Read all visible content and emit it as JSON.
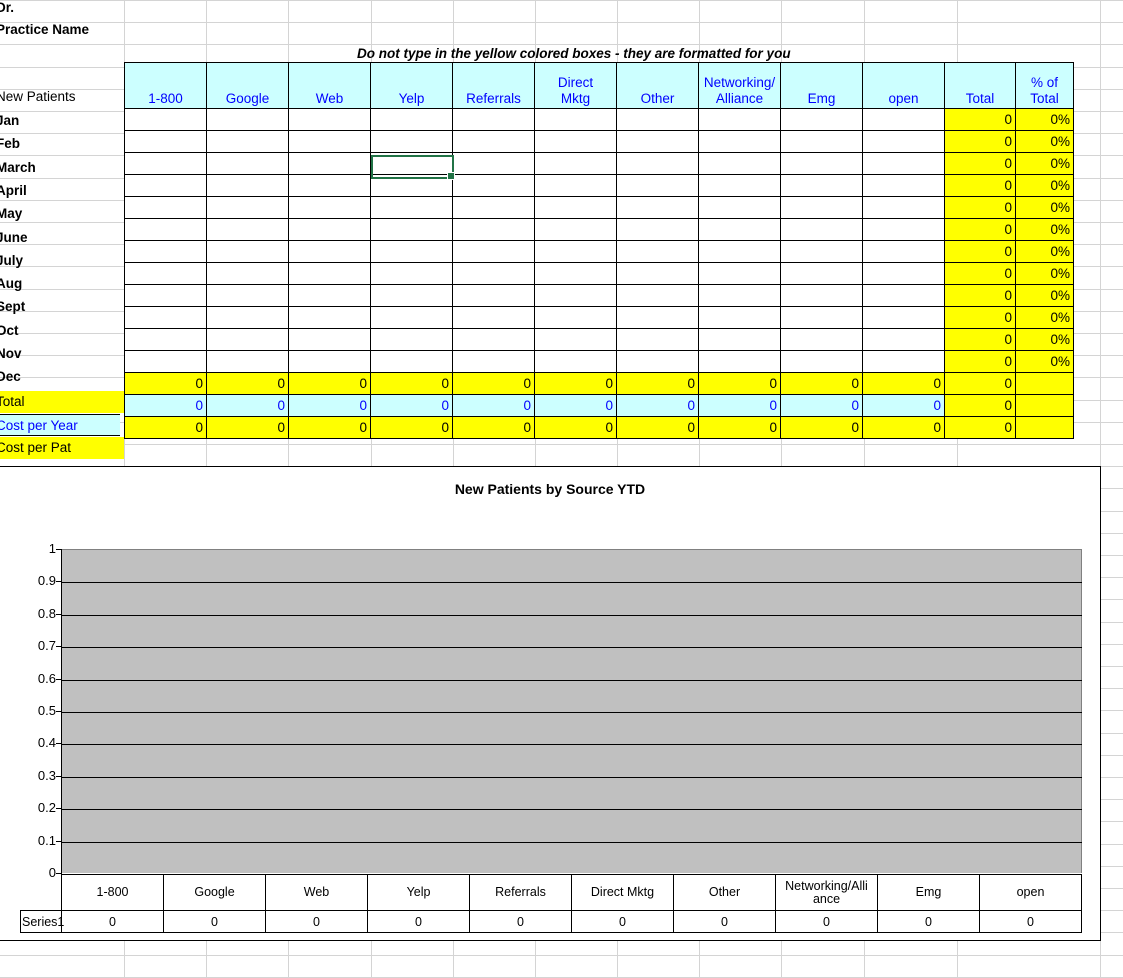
{
  "sheet": {
    "label_dr": "Dr.",
    "label_practice": "Practice Name",
    "label_new_patients": "New Patients",
    "note": "Do not type in the yellow colored boxes -  they are formatted for you"
  },
  "table": {
    "columns": [
      "1-800",
      "Google",
      "Web",
      "Yelp",
      "Referrals",
      "Direct Mktg",
      "Other",
      "Networking/Alliance",
      "Emg",
      "open"
    ],
    "columns_wrapped": [
      [
        "1-800"
      ],
      [
        "Google"
      ],
      [
        "Web"
      ],
      [
        "Yelp"
      ],
      [
        "Referrals"
      ],
      [
        "Direct",
        "Mktg"
      ],
      [
        "Other"
      ],
      [
        "Networking/",
        "Alliance"
      ],
      [
        "Emg"
      ],
      [
        "open"
      ]
    ],
    "total_header": "Total",
    "pct_header_wrapped": [
      "% of",
      "Total"
    ],
    "months": [
      "Jan",
      "Feb",
      "March",
      "April",
      "May",
      "June",
      "July",
      "Aug",
      "Sept",
      "Oct",
      "Nov",
      "Dec"
    ],
    "month_values": [
      [
        "",
        "",
        "",
        "",
        "",
        "",
        "",
        "",
        "",
        ""
      ],
      [
        "",
        "",
        "",
        "",
        "",
        "",
        "",
        "",
        "",
        ""
      ],
      [
        "",
        "",
        "",
        "",
        "",
        "",
        "",
        "",
        "",
        ""
      ],
      [
        "",
        "",
        "",
        "",
        "",
        "",
        "",
        "",
        "",
        ""
      ],
      [
        "",
        "",
        "",
        "",
        "",
        "",
        "",
        "",
        "",
        ""
      ],
      [
        "",
        "",
        "",
        "",
        "",
        "",
        "",
        "",
        "",
        ""
      ],
      [
        "",
        "",
        "",
        "",
        "",
        "",
        "",
        "",
        "",
        ""
      ],
      [
        "",
        "",
        "",
        "",
        "",
        "",
        "",
        "",
        "",
        ""
      ],
      [
        "",
        "",
        "",
        "",
        "",
        "",
        "",
        "",
        "",
        ""
      ],
      [
        "",
        "",
        "",
        "",
        "",
        "",
        "",
        "",
        "",
        ""
      ],
      [
        "",
        "",
        "",
        "",
        "",
        "",
        "",
        "",
        "",
        ""
      ],
      [
        "",
        "",
        "",
        "",
        "",
        "",
        "",
        "",
        "",
        ""
      ]
    ],
    "month_totals": [
      "0",
      "0",
      "0",
      "0",
      "0",
      "0",
      "0",
      "0",
      "0",
      "0",
      "0",
      "0"
    ],
    "month_pcts": [
      "0%",
      "0%",
      "0%",
      "0%",
      "0%",
      "0%",
      "0%",
      "0%",
      "0%",
      "0%",
      "0%",
      "0%"
    ],
    "summary_rows": [
      {
        "label": "Total",
        "style": "yellow",
        "values": [
          "0",
          "0",
          "0",
          "0",
          "0",
          "0",
          "0",
          "0",
          "0",
          "0"
        ],
        "total": "0",
        "pct": ""
      },
      {
        "label": "Cost per Year",
        "style": "cyan",
        "values": [
          "0",
          "0",
          "0",
          "0",
          "0",
          "0",
          "0",
          "0",
          "0",
          "0"
        ],
        "total": "0",
        "pct": ""
      },
      {
        "label": "Cost per Pat",
        "style": "yellow",
        "values": [
          "0",
          "0",
          "0",
          "0",
          "0",
          "0",
          "0",
          "0",
          "0",
          "0"
        ],
        "total": "0",
        "pct": ""
      }
    ]
  },
  "selection": {
    "cell_label": "March-Yelp",
    "border_color": "#217346"
  },
  "chart_data": {
    "type": "bar",
    "title": "New Patients by Source YTD",
    "xlabel": "",
    "ylabel": "",
    "ylim": [
      0,
      1
    ],
    "grid": true,
    "legend": false,
    "plot_bgcolor": "#C0C0C0",
    "categories": [
      "1-800",
      "Google",
      "Web",
      "Yelp",
      "Referrals",
      "Direct Mktg",
      "Networking/Alliance",
      "Other",
      "Emg",
      "open"
    ],
    "data_table_categories": [
      "1-800",
      "Google",
      "Web",
      "Yelp",
      "Referrals",
      "Direct Mktg",
      "Other",
      "Networking/Alli ance",
      "Emg",
      "open"
    ],
    "data_table_categories_wrapped": [
      [
        "1-800"
      ],
      [
        "Google"
      ],
      [
        "Web"
      ],
      [
        "Yelp"
      ],
      [
        "Referrals"
      ],
      [
        "Direct Mktg"
      ],
      [
        "Other"
      ],
      [
        "Networking/Alli",
        "ance"
      ],
      [
        "Emg"
      ],
      [
        "open"
      ]
    ],
    "series": [
      {
        "name": "Series1",
        "values": [
          0,
          0,
          0,
          0,
          0,
          0,
          0,
          0,
          0,
          0
        ],
        "value_labels": [
          "0",
          "0",
          "0",
          "0",
          "0",
          "0",
          "0",
          "0",
          "0",
          "0"
        ]
      }
    ],
    "ytick_labels": [
      "1",
      "0.9",
      "0.8",
      "0.7",
      "0.6",
      "0.5",
      "0.4",
      "0.3",
      "0.2",
      "0.1",
      "0"
    ],
    "ytick_values": [
      1,
      0.9,
      0.8,
      0.7,
      0.6,
      0.5,
      0.4,
      0.3,
      0.2,
      0.1,
      0
    ]
  },
  "colors": {
    "header_cyan": "#CCFFFF",
    "yellow": "#FFFF00",
    "blue_text": "#0000FF",
    "plot_gray": "#C0C0C0",
    "selection_green": "#217346"
  }
}
